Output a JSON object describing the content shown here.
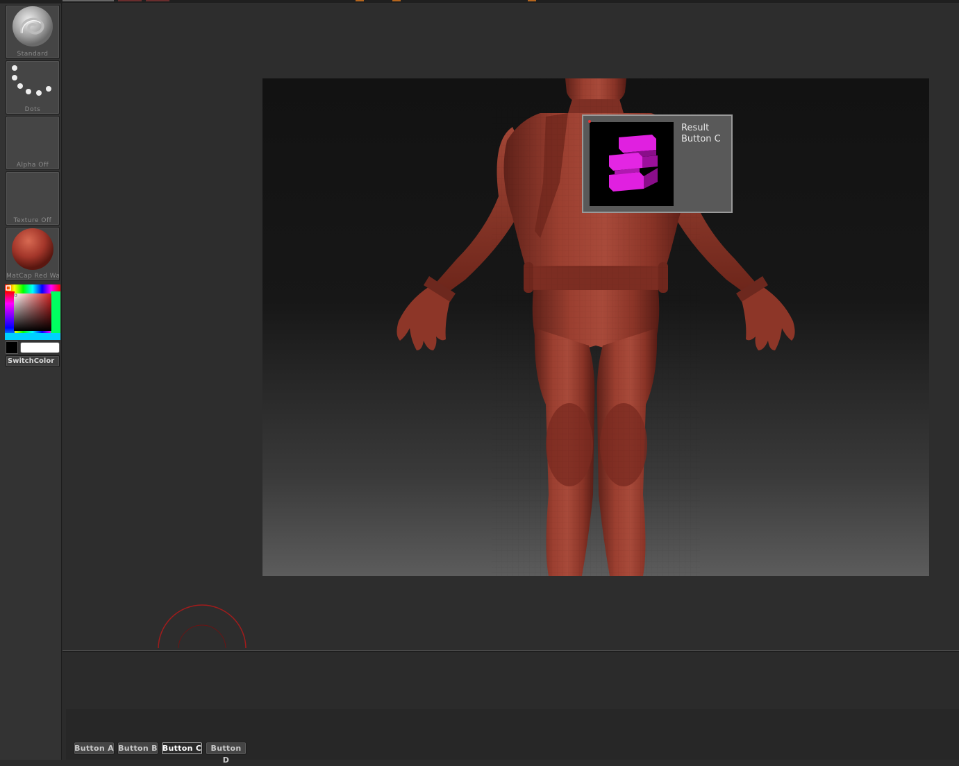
{
  "left_shelf": {
    "brush_label": "Standard",
    "stroke_label": "Dots",
    "alpha_label": "Alpha  Off",
    "texture_label": "Texture  Off",
    "material_label": "MatCap  Red  Wa",
    "switch_color_label": "SwitchColor",
    "main_color": "#000000",
    "secondary_color": "#ffffff",
    "material_color": "#b0442e"
  },
  "popup": {
    "line1": "Result",
    "line2": "Button C",
    "icon": "magenta-zigzag-cube-icon",
    "icon_color": "#d81ed8"
  },
  "bottom_buttons": [
    {
      "label": "Button  A",
      "active": false
    },
    {
      "label": "Button  B",
      "active": false
    },
    {
      "label": "Button  C",
      "active": true
    },
    {
      "label": "Button  D",
      "active": false
    }
  ],
  "viewport": {
    "model": "human-figure-model",
    "model_color": "#8c3528",
    "background_top": "#121212",
    "background_bottom": "#5c5c5c"
  }
}
